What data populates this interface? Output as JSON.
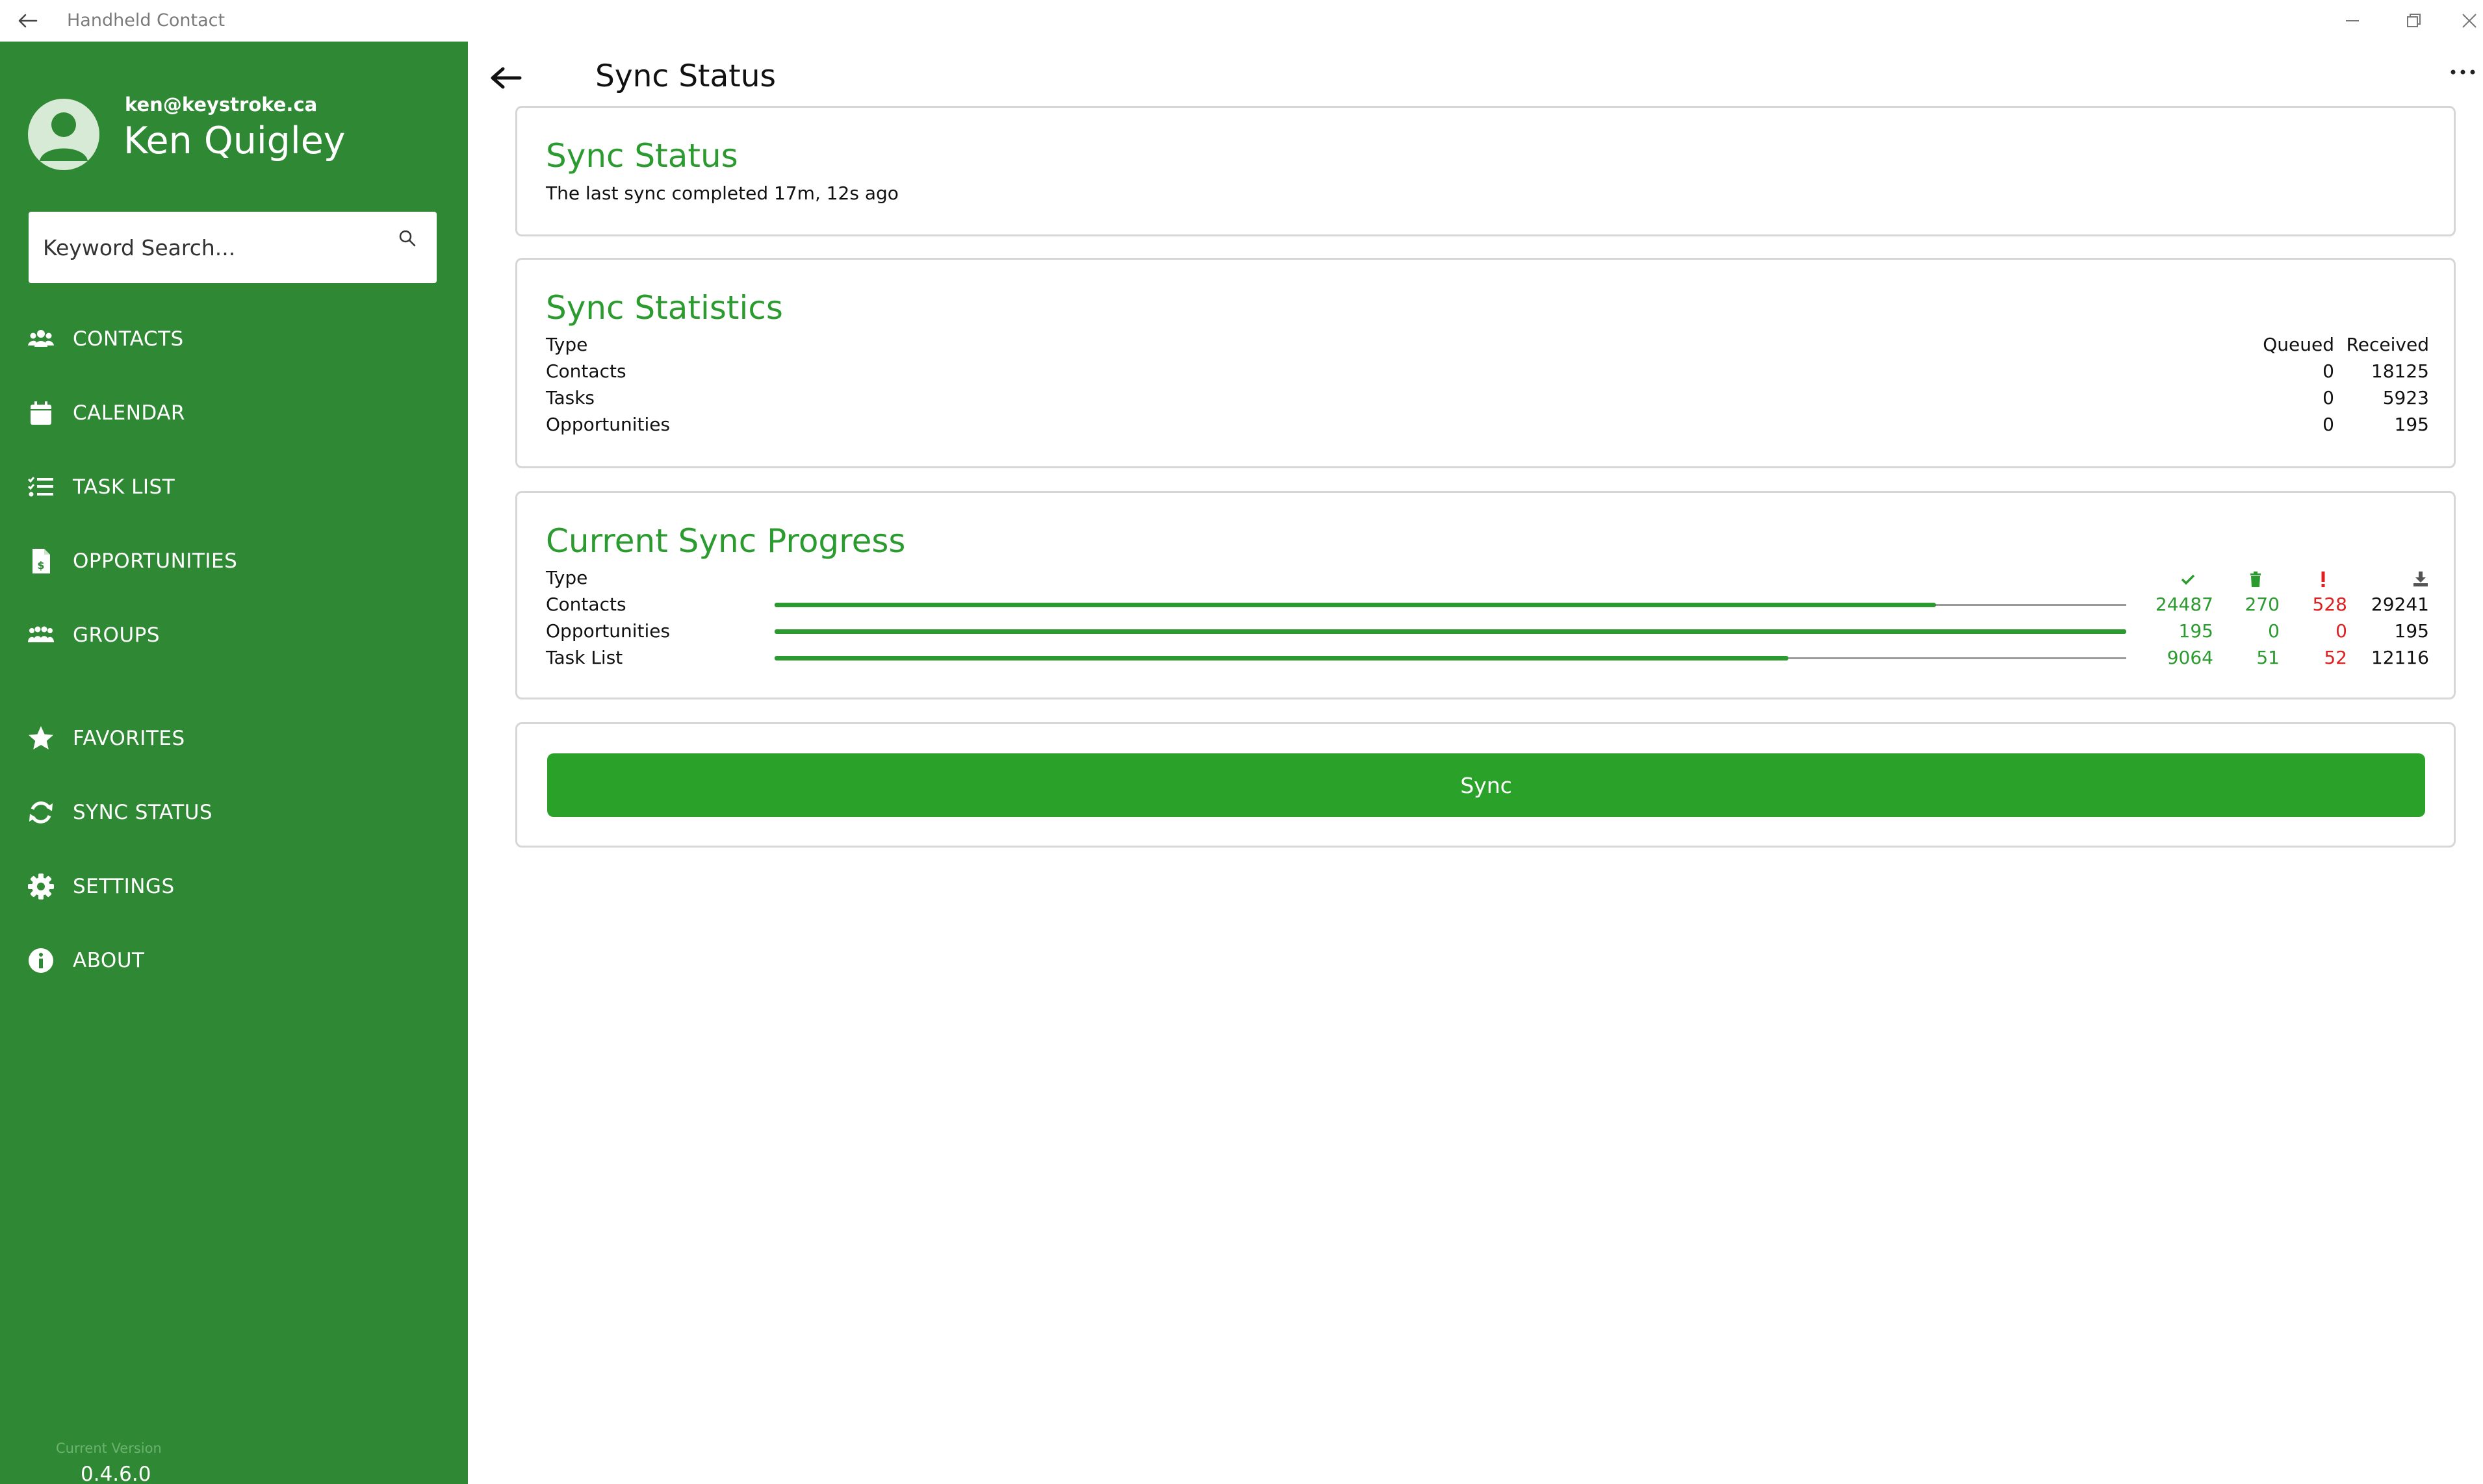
{
  "window": {
    "title": "Handheld Contact"
  },
  "sidebar": {
    "user_email": "ken@keystroke.ca",
    "user_name": "Ken Quigley",
    "search_placeholder": "Keyword Search...",
    "items": [
      {
        "label": "CONTACTS",
        "icon": "contacts-icon"
      },
      {
        "label": "CALENDAR",
        "icon": "calendar-icon"
      },
      {
        "label": "TASK LIST",
        "icon": "task-list-icon"
      },
      {
        "label": "OPPORTUNITIES",
        "icon": "opportunities-icon"
      },
      {
        "label": "GROUPS",
        "icon": "groups-icon"
      },
      {
        "label": "FAVORITES",
        "icon": "star-icon"
      },
      {
        "label": "SYNC STATUS",
        "icon": "sync-icon"
      },
      {
        "label": "SETTINGS",
        "icon": "gear-icon"
      },
      {
        "label": "ABOUT",
        "icon": "info-icon"
      }
    ],
    "version_label": "Current Version",
    "version_value": "0.4.6.0"
  },
  "header": {
    "title": "Sync Status"
  },
  "sync_status": {
    "title": "Sync Status",
    "message": "The last sync completed 17m, 12s ago"
  },
  "sync_statistics": {
    "title": "Sync Statistics",
    "columns": {
      "type": "Type",
      "queued": "Queued",
      "received": "Received"
    },
    "rows": [
      {
        "type": "Contacts",
        "queued": "0",
        "received": "18125"
      },
      {
        "type": "Tasks",
        "queued": "0",
        "received": "5923"
      },
      {
        "type": "Opportunities",
        "queued": "0",
        "received": "195"
      }
    ]
  },
  "current_sync_progress": {
    "title": "Current Sync Progress",
    "type_header": "Type",
    "column_icons": [
      "check-icon",
      "trash-icon",
      "exclamation-icon",
      "download-icon"
    ],
    "rows": [
      {
        "type": "Contacts",
        "progress": 0.859,
        "completed": "24487",
        "deleted": "270",
        "errors": "528",
        "total": "29241"
      },
      {
        "type": "Opportunities",
        "progress": 1.0,
        "completed": "195",
        "deleted": "0",
        "errors": "0",
        "total": "195"
      },
      {
        "type": "Task List",
        "progress": 0.75,
        "completed": "9064",
        "deleted": "51",
        "errors": "52",
        "total": "12116"
      }
    ]
  },
  "sync_button": {
    "label": "Sync"
  },
  "colors": {
    "sidebar": "#2f8833",
    "accent": "#2b9a2f",
    "error": "#e02020",
    "button": "#2aa22a"
  }
}
